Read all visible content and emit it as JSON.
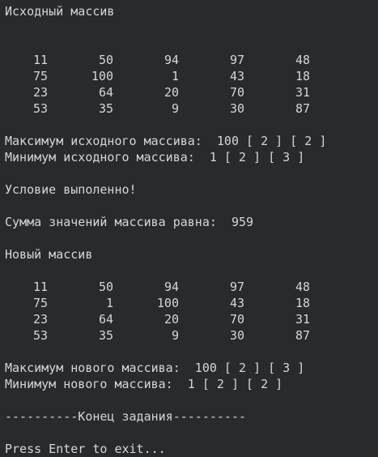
{
  "console": {
    "original_title": "Исходный массив",
    "original_matrix": [
      [
        "11",
        "50",
        "94",
        "97",
        "48"
      ],
      [
        "75",
        "100",
        "1",
        "43",
        "18"
      ],
      [
        "23",
        "64",
        "20",
        "70",
        "31"
      ],
      [
        "53",
        "35",
        "9",
        "30",
        "87"
      ]
    ],
    "original_max_line": "Максимум исходного массива:  100 [ 2 ] [ 2 ]",
    "original_min_line": "Минимум исходного массива:  1 [ 2 ] [ 3 ]",
    "condition_line": "Условие выполенно!",
    "sum_line": "Сумма значений массива равна:  959",
    "new_title": "Новый массив",
    "new_matrix": [
      [
        "11",
        "50",
        "94",
        "97",
        "48"
      ],
      [
        "75",
        "1",
        "100",
        "43",
        "18"
      ],
      [
        "23",
        "64",
        "20",
        "70",
        "31"
      ],
      [
        "53",
        "35",
        "9",
        "30",
        "87"
      ]
    ],
    "new_max_line": "Максимум нового массива:  100 [ 2 ] [ 3 ]",
    "new_min_line": "Минимум нового массива:  1 [ 2 ] [ 2 ]",
    "end_line": "----------Конец задания----------",
    "prompt_line": "Press Enter to exit..."
  }
}
